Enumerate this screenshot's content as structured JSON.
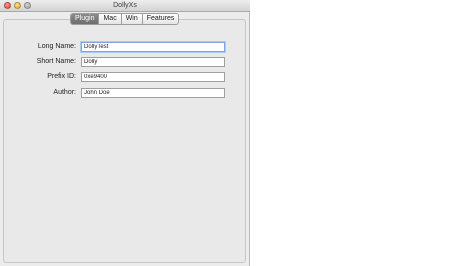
{
  "window": {
    "title": "DollyXs"
  },
  "tabs": [
    {
      "label": "Plugin",
      "selected": true
    },
    {
      "label": "Mac",
      "selected": false
    },
    {
      "label": "Win",
      "selected": false
    },
    {
      "label": "Features",
      "selected": false
    }
  ],
  "form": {
    "long_name": {
      "label": "Long Name:",
      "value": "DollyTest"
    },
    "short_name": {
      "label": "Short Name:",
      "value": "Dolly"
    },
    "prefix_id": {
      "label": "Prefix ID:",
      "value": "0xe9400"
    },
    "author": {
      "label": "Author:",
      "value": "John Doe"
    }
  },
  "colors": {
    "window_bg": "#ececec",
    "selected_tab_bg": "#7a7a7a",
    "focus_ring": "#7ea6dc"
  }
}
